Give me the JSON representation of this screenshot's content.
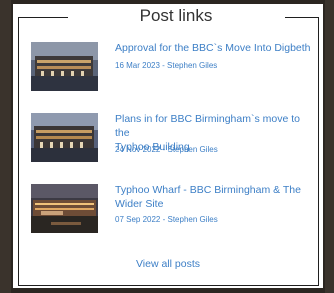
{
  "widget": {
    "title": "Post links",
    "view_all_label": "View all posts"
  },
  "posts": [
    {
      "title_lines": [
        "Approval for the BBC`s Move Into Digbeth"
      ],
      "date": "16 Mar 2023",
      "author": "Stephen Giles",
      "separator": " - "
    },
    {
      "title_lines": [
        "Plans in for BBC Birmingham`s move to the",
        "Typhoo Building"
      ],
      "date": "24 Nov 2022",
      "author": "Stephen Giles",
      "separator": " - "
    },
    {
      "title_lines": [
        "Typhoo Wharf - BBC Birmingham & The",
        "Wider Site"
      ],
      "date": "07 Sep 2022",
      "author": "Stephen Giles",
      "separator": " - "
    }
  ]
}
